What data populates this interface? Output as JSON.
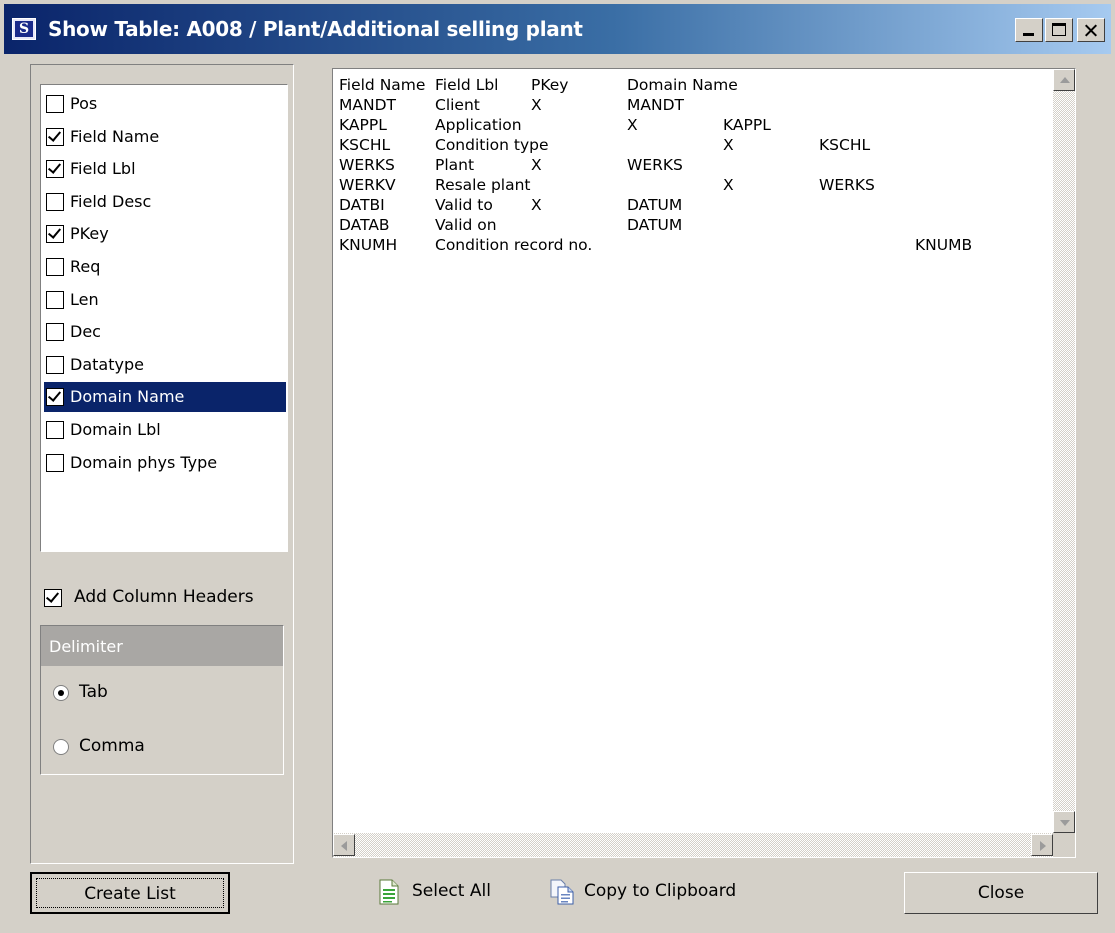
{
  "window": {
    "title": "Show Table: A008 / Plant/Additional selling plant",
    "icon": "S"
  },
  "fields": [
    {
      "label": "Pos",
      "checked": false
    },
    {
      "label": "Field Name",
      "checked": true
    },
    {
      "label": "Field Lbl",
      "checked": true
    },
    {
      "label": "Field Desc",
      "checked": false
    },
    {
      "label": "PKey",
      "checked": true
    },
    {
      "label": "Req",
      "checked": false
    },
    {
      "label": "Len",
      "checked": false
    },
    {
      "label": "Dec",
      "checked": false
    },
    {
      "label": "Datatype",
      "checked": false
    },
    {
      "label": "Domain Name",
      "checked": true,
      "selected": true
    },
    {
      "label": "Domain Lbl",
      "checked": false
    },
    {
      "label": "Domain phys Type",
      "checked": false
    }
  ],
  "options": {
    "add_headers_label": "Add Column Headers",
    "add_headers_checked": true
  },
  "delimiter": {
    "title": "Delimiter",
    "options": [
      {
        "label": "Tab",
        "selected": true
      },
      {
        "label": "Comma",
        "selected": false
      }
    ]
  },
  "output": {
    "lines": [
      [
        "Field Name",
        "Field Lbl",
        "PKey",
        "Domain Name"
      ],
      [
        "MANDT",
        "Client",
        "X",
        "MANDT"
      ],
      [
        "KAPPL",
        "Application",
        "",
        "X",
        "KAPPL"
      ],
      [
        "KSCHL",
        "Condition type",
        "",
        "X",
        "KSCHL"
      ],
      [
        "WERKS",
        "Plant",
        "X",
        "WERKS"
      ],
      [
        "WERKV",
        "Resale plant",
        "",
        "X",
        "WERKS"
      ],
      [
        "DATBI",
        "Valid to",
        "X",
        "DATUM"
      ],
      [
        "DATAB",
        "Valid on",
        "",
        "DATUM"
      ],
      [
        "KNUMH",
        "Condition record no.",
        "",
        "",
        "",
        "KNUMB"
      ]
    ]
  },
  "buttons": {
    "create_list": "Create List",
    "select_all": "Select All",
    "copy_clipboard": "Copy to Clipboard",
    "close": "Close"
  },
  "colors": {
    "title_gradient_start": "#0a246a",
    "selection": "#0a246a",
    "face": "#d4d0c8"
  }
}
